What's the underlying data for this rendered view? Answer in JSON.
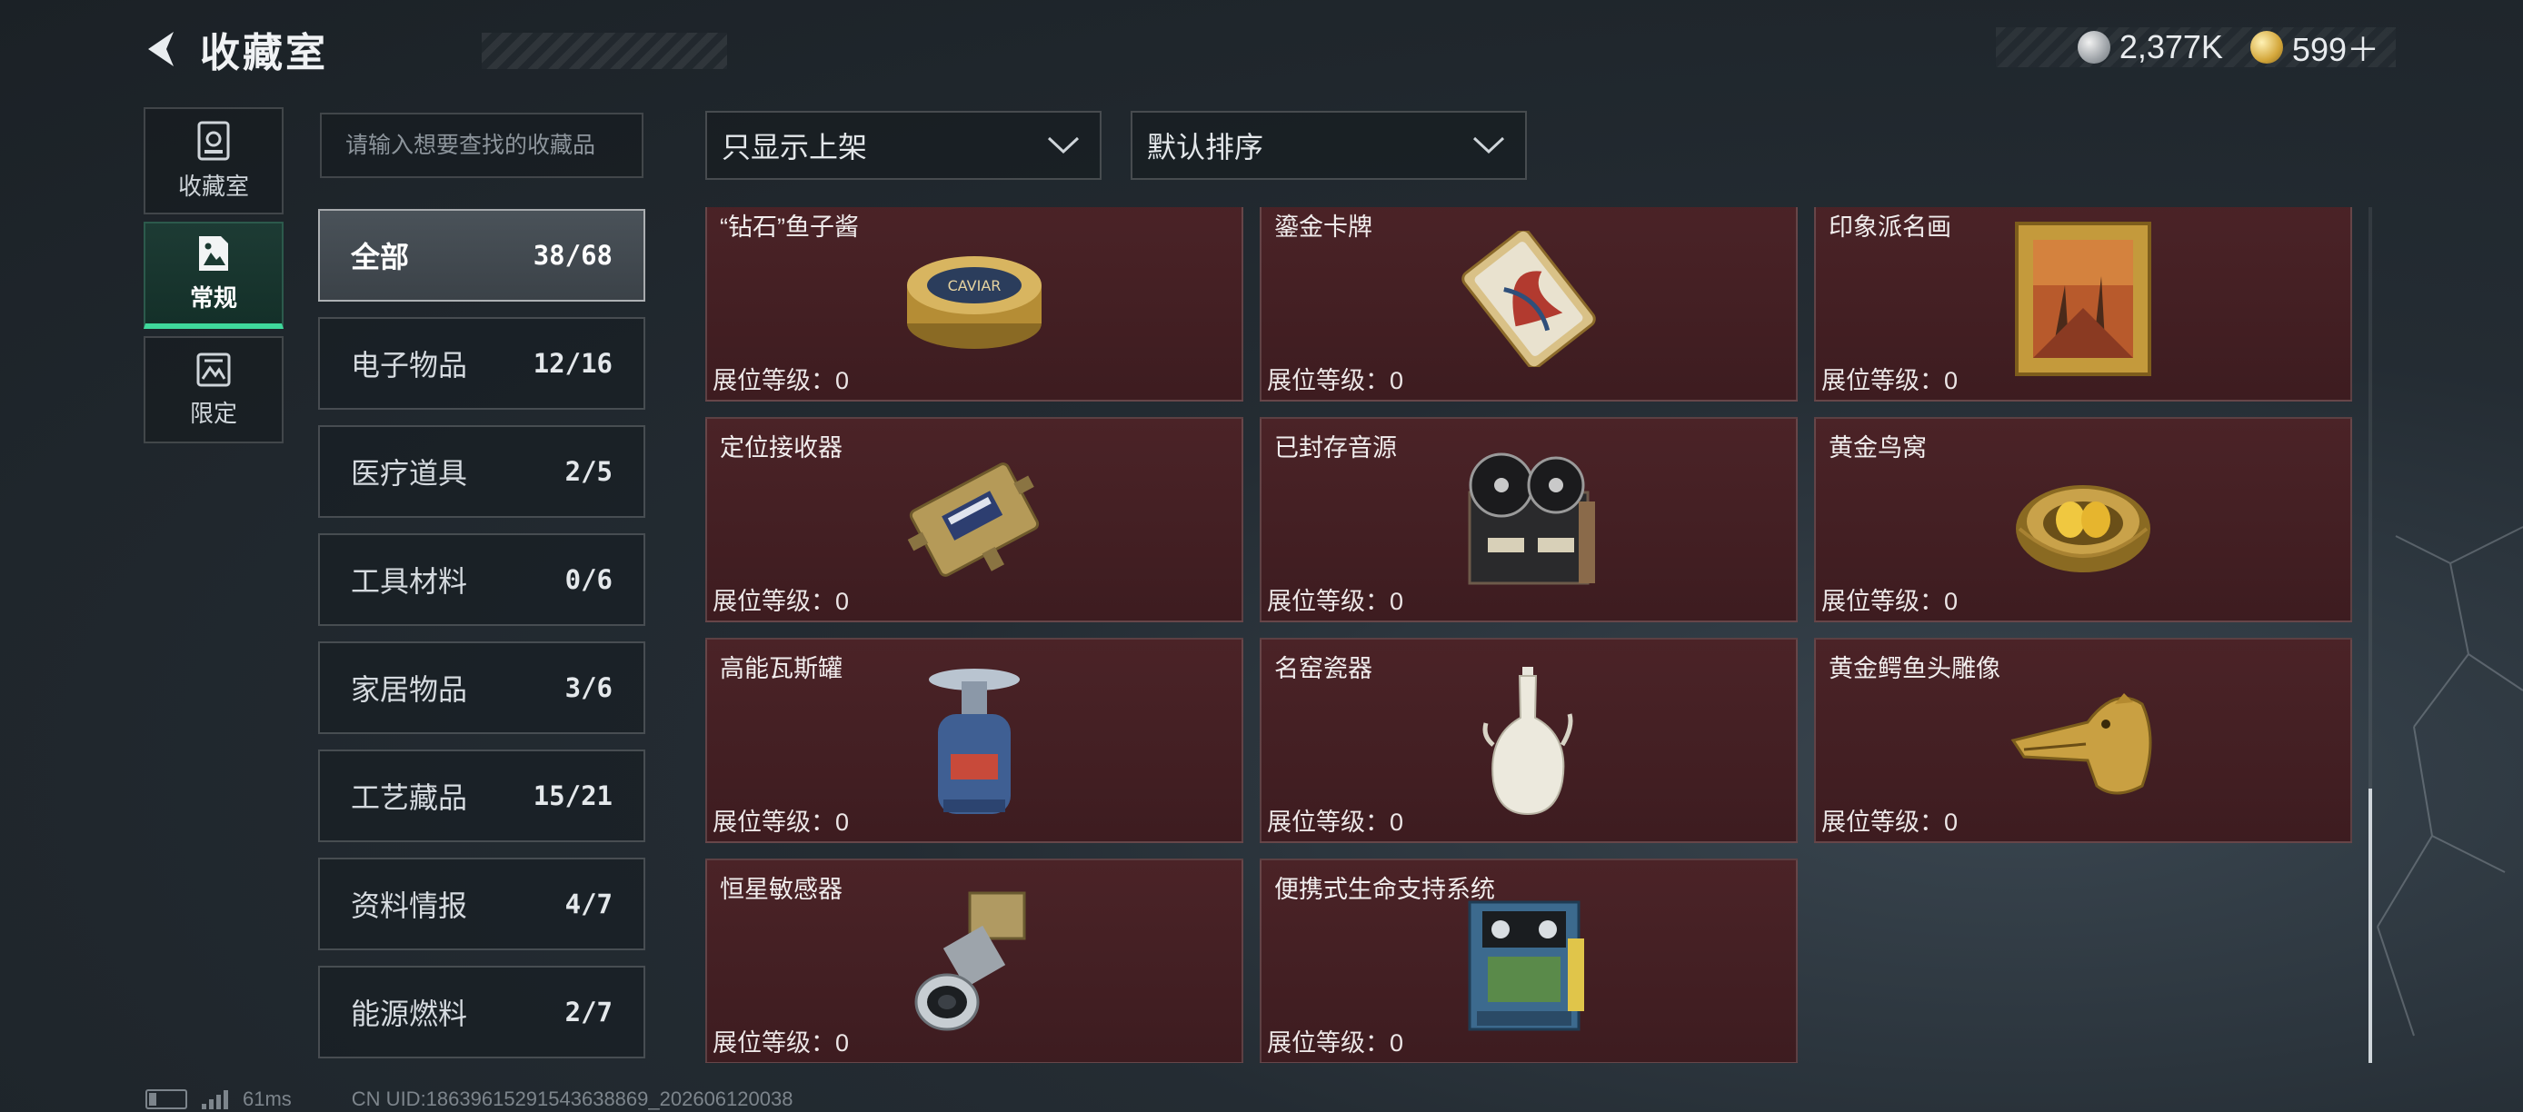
{
  "header": {
    "title": "收藏室"
  },
  "currency": {
    "silver": "2,377K",
    "gold": "599＋"
  },
  "side_tabs": [
    {
      "label": "收藏室",
      "icon": "vault-icon"
    },
    {
      "label": "常规",
      "icon": "gallery-icon",
      "active": true
    },
    {
      "label": "限定",
      "icon": "limited-icon"
    }
  ],
  "search": {
    "placeholder": "请输入想要查找的收藏品",
    "value": ""
  },
  "categories": [
    {
      "name": "全部",
      "count": "38/68",
      "active": true
    },
    {
      "name": "电子物品",
      "count": "12/16"
    },
    {
      "name": "医疗道具",
      "count": "2/5"
    },
    {
      "name": "工具材料",
      "count": "0/6"
    },
    {
      "name": "家居物品",
      "count": "3/6"
    },
    {
      "name": "工艺藏品",
      "count": "15/21"
    },
    {
      "name": "资料情报",
      "count": "4/7"
    },
    {
      "name": "能源燃料",
      "count": "2/7"
    }
  ],
  "filters": {
    "display": "只显示上架",
    "sort": "默认排序"
  },
  "level_label": "展位等级：",
  "items": [
    {
      "name": "“钻石”鱼子酱",
      "level": "0",
      "icon": "caviar-tin-icon"
    },
    {
      "name": "鎏金卡牌",
      "level": "0",
      "icon": "gilded-card-icon"
    },
    {
      "name": "印象派名画",
      "level": "0",
      "icon": "framed-painting-icon"
    },
    {
      "name": "定位接收器",
      "level": "0",
      "icon": "locator-receiver-icon"
    },
    {
      "name": "已封存音源",
      "level": "0",
      "icon": "reel-recorder-icon"
    },
    {
      "name": "黄金鸟窝",
      "level": "0",
      "icon": "golden-nest-icon"
    },
    {
      "name": "高能瓦斯罐",
      "level": "0",
      "icon": "gas-canister-icon"
    },
    {
      "name": "名窑瓷器",
      "level": "0",
      "icon": "porcelain-vase-icon"
    },
    {
      "name": "黄金鳄鱼头雕像",
      "level": "0",
      "icon": "gold-crocodile-icon"
    },
    {
      "name": "恒星敏感器",
      "level": "0",
      "icon": "star-sensor-icon"
    },
    {
      "name": "便携式生命支持系统",
      "level": "0",
      "icon": "life-support-icon"
    }
  ],
  "footer": {
    "ping": "61ms",
    "uid": "CN UID:18639615291543638869_202606120038"
  },
  "colors": {
    "accent": "#3fd89b",
    "card_bg": "#4b2327"
  }
}
